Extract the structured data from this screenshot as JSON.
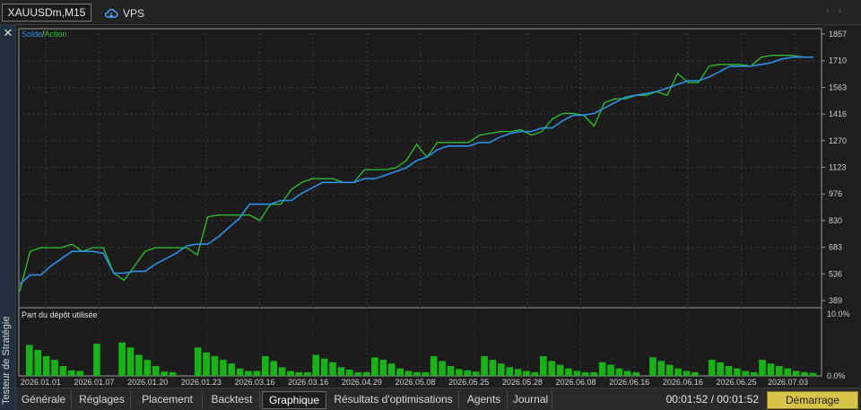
{
  "window": {
    "symbol_tab": "XAUUSDm,M15",
    "vps_label": "VPS",
    "side_title": "Testeur de Stratégie"
  },
  "legend": {
    "solde": "Solde",
    "separator": "/",
    "action": "Action"
  },
  "subchart_title": "Part du dépôt utilisée",
  "colors": {
    "balance": "#2d8fe6",
    "equity": "#2fc12f",
    "bars": "#19b319",
    "accent_button": "#d9c44a"
  },
  "chart_data": {
    "type": "line",
    "y_ticks": [
      1857,
      1710,
      1563,
      1416,
      1270,
      1123,
      976,
      830,
      683,
      536,
      389
    ],
    "ylim": [
      389,
      1857
    ],
    "x_ticks": [
      "2026.01.01",
      "2026.01.07",
      "2026.01.20",
      "2026.01.23",
      "2026.03.16",
      "2026.03.16",
      "2026.04.29",
      "2026.05.08",
      "2026.05.25",
      "2026.05.28",
      "2026.06.08",
      "2026.06.16",
      "2026.06.16",
      "2026.06.25",
      "2026.07.03"
    ],
    "series": [
      {
        "name": "Solde",
        "values": [
          480,
          530,
          530,
          580,
          620,
          660,
          660,
          660,
          650,
          540,
          540,
          550,
          550,
          590,
          620,
          650,
          690,
          700,
          700,
          740,
          790,
          840,
          920,
          920,
          920,
          940,
          940,
          980,
          1010,
          1040,
          1040,
          1040,
          1040,
          1060,
          1060,
          1080,
          1100,
          1120,
          1160,
          1180,
          1220,
          1240,
          1240,
          1240,
          1260,
          1260,
          1290,
          1310,
          1320,
          1320,
          1340,
          1340,
          1380,
          1410,
          1410,
          1420,
          1450,
          1480,
          1510,
          1520,
          1530,
          1540,
          1560,
          1580,
          1600,
          1600,
          1620,
          1650,
          1680,
          1680,
          1680,
          1690,
          1700,
          1720,
          1730,
          1730,
          1730
        ]
      },
      {
        "name": "Action",
        "values": [
          440,
          660,
          680,
          680,
          680,
          700,
          660,
          680,
          680,
          540,
          500,
          580,
          660,
          680,
          680,
          680,
          680,
          640,
          850,
          860,
          860,
          860,
          860,
          830,
          920,
          920,
          1000,
          1040,
          1060,
          1060,
          1060,
          1040,
          1040,
          1110,
          1110,
          1110,
          1120,
          1160,
          1250,
          1180,
          1260,
          1260,
          1260,
          1260,
          1300,
          1310,
          1320,
          1320,
          1330,
          1300,
          1320,
          1390,
          1420,
          1420,
          1410,
          1350,
          1480,
          1500,
          1500,
          1520,
          1520,
          1540,
          1520,
          1640,
          1590,
          1590,
          1680,
          1690,
          1690,
          1690,
          1680,
          1730,
          1740,
          1740,
          1740,
          1730,
          1730
        ]
      }
    ],
    "subchart": {
      "type": "bar",
      "name": "Part du dépôt utilisée",
      "y_ticks": [
        "10.0%",
        "0.0%"
      ],
      "ylim": [
        0,
        10
      ],
      "values": [
        5.0,
        4.2,
        3.2,
        2.6,
        1.6,
        0.9,
        0.8,
        0,
        5.2,
        0,
        0,
        5.4,
        4.6,
        3.4,
        2.6,
        1.6,
        0.7,
        0.6,
        0,
        0,
        4.6,
        3.8,
        3.2,
        2.6,
        2.0,
        1.2,
        0.8,
        0.8,
        3.2,
        2.4,
        1.4,
        0.8,
        0.6,
        0.6,
        3.4,
        2.8,
        2.2,
        1.4,
        1.0,
        0.6,
        0.6,
        3.0,
        2.6,
        2.0,
        1.2,
        0.8,
        0.6,
        0.6,
        3.2,
        2.4,
        1.6,
        1.1,
        0.9,
        0.7,
        3.2,
        2.6,
        2.0,
        1.4,
        1.1,
        0.8,
        0.6,
        3.2,
        2.4,
        1.8,
        1.2,
        0.8,
        0.6,
        0.6,
        2.2,
        1.8,
        1.2,
        0.8,
        0.6,
        0,
        3.0,
        2.4,
        1.8,
        1.2,
        0.8,
        0.6,
        0,
        2.6,
        2.2,
        1.6,
        1.2,
        0.8,
        0.6,
        2.6,
        2.0,
        1.6,
        1.2,
        0.8,
        0.6,
        0.5
      ]
    }
  },
  "bottom": {
    "tabs": [
      "Générale",
      "Réglages",
      "Placement",
      "Backtest",
      "Graphique",
      "Résultats d'optimisations",
      "Agents",
      "Journal"
    ],
    "active_tab": "Graphique",
    "timer": "00:01:52 / 00:01:52",
    "start_label": "Démarrage"
  }
}
